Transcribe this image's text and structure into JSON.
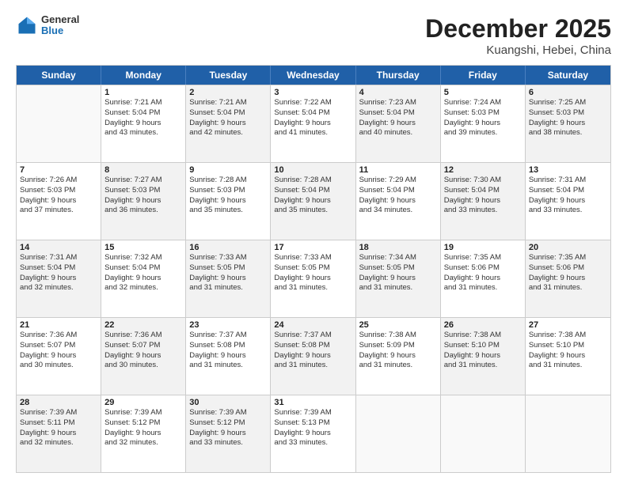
{
  "logo": {
    "general": "General",
    "blue": "Blue"
  },
  "header": {
    "title": "December 2025",
    "subtitle": "Kuangshi, Hebei, China"
  },
  "weekdays": [
    "Sunday",
    "Monday",
    "Tuesday",
    "Wednesday",
    "Thursday",
    "Friday",
    "Saturday"
  ],
  "weeks": [
    [
      {
        "day": "",
        "lines": [],
        "shade": false
      },
      {
        "day": "1",
        "lines": [
          "Sunrise: 7:21 AM",
          "Sunset: 5:04 PM",
          "Daylight: 9 hours",
          "and 43 minutes."
        ],
        "shade": false
      },
      {
        "day": "2",
        "lines": [
          "Sunrise: 7:21 AM",
          "Sunset: 5:04 PM",
          "Daylight: 9 hours",
          "and 42 minutes."
        ],
        "shade": true
      },
      {
        "day": "3",
        "lines": [
          "Sunrise: 7:22 AM",
          "Sunset: 5:04 PM",
          "Daylight: 9 hours",
          "and 41 minutes."
        ],
        "shade": false
      },
      {
        "day": "4",
        "lines": [
          "Sunrise: 7:23 AM",
          "Sunset: 5:04 PM",
          "Daylight: 9 hours",
          "and 40 minutes."
        ],
        "shade": true
      },
      {
        "day": "5",
        "lines": [
          "Sunrise: 7:24 AM",
          "Sunset: 5:03 PM",
          "Daylight: 9 hours",
          "and 39 minutes."
        ],
        "shade": false
      },
      {
        "day": "6",
        "lines": [
          "Sunrise: 7:25 AM",
          "Sunset: 5:03 PM",
          "Daylight: 9 hours",
          "and 38 minutes."
        ],
        "shade": true
      }
    ],
    [
      {
        "day": "7",
        "lines": [
          "Sunrise: 7:26 AM",
          "Sunset: 5:03 PM",
          "Daylight: 9 hours",
          "and 37 minutes."
        ],
        "shade": false
      },
      {
        "day": "8",
        "lines": [
          "Sunrise: 7:27 AM",
          "Sunset: 5:03 PM",
          "Daylight: 9 hours",
          "and 36 minutes."
        ],
        "shade": true
      },
      {
        "day": "9",
        "lines": [
          "Sunrise: 7:28 AM",
          "Sunset: 5:03 PM",
          "Daylight: 9 hours",
          "and 35 minutes."
        ],
        "shade": false
      },
      {
        "day": "10",
        "lines": [
          "Sunrise: 7:28 AM",
          "Sunset: 5:04 PM",
          "Daylight: 9 hours",
          "and 35 minutes."
        ],
        "shade": true
      },
      {
        "day": "11",
        "lines": [
          "Sunrise: 7:29 AM",
          "Sunset: 5:04 PM",
          "Daylight: 9 hours",
          "and 34 minutes."
        ],
        "shade": false
      },
      {
        "day": "12",
        "lines": [
          "Sunrise: 7:30 AM",
          "Sunset: 5:04 PM",
          "Daylight: 9 hours",
          "and 33 minutes."
        ],
        "shade": true
      },
      {
        "day": "13",
        "lines": [
          "Sunrise: 7:31 AM",
          "Sunset: 5:04 PM",
          "Daylight: 9 hours",
          "and 33 minutes."
        ],
        "shade": false
      }
    ],
    [
      {
        "day": "14",
        "lines": [
          "Sunrise: 7:31 AM",
          "Sunset: 5:04 PM",
          "Daylight: 9 hours",
          "and 32 minutes."
        ],
        "shade": true
      },
      {
        "day": "15",
        "lines": [
          "Sunrise: 7:32 AM",
          "Sunset: 5:04 PM",
          "Daylight: 9 hours",
          "and 32 minutes."
        ],
        "shade": false
      },
      {
        "day": "16",
        "lines": [
          "Sunrise: 7:33 AM",
          "Sunset: 5:05 PM",
          "Daylight: 9 hours",
          "and 31 minutes."
        ],
        "shade": true
      },
      {
        "day": "17",
        "lines": [
          "Sunrise: 7:33 AM",
          "Sunset: 5:05 PM",
          "Daylight: 9 hours",
          "and 31 minutes."
        ],
        "shade": false
      },
      {
        "day": "18",
        "lines": [
          "Sunrise: 7:34 AM",
          "Sunset: 5:05 PM",
          "Daylight: 9 hours",
          "and 31 minutes."
        ],
        "shade": true
      },
      {
        "day": "19",
        "lines": [
          "Sunrise: 7:35 AM",
          "Sunset: 5:06 PM",
          "Daylight: 9 hours",
          "and 31 minutes."
        ],
        "shade": false
      },
      {
        "day": "20",
        "lines": [
          "Sunrise: 7:35 AM",
          "Sunset: 5:06 PM",
          "Daylight: 9 hours",
          "and 31 minutes."
        ],
        "shade": true
      }
    ],
    [
      {
        "day": "21",
        "lines": [
          "Sunrise: 7:36 AM",
          "Sunset: 5:07 PM",
          "Daylight: 9 hours",
          "and 30 minutes."
        ],
        "shade": false
      },
      {
        "day": "22",
        "lines": [
          "Sunrise: 7:36 AM",
          "Sunset: 5:07 PM",
          "Daylight: 9 hours",
          "and 30 minutes."
        ],
        "shade": true
      },
      {
        "day": "23",
        "lines": [
          "Sunrise: 7:37 AM",
          "Sunset: 5:08 PM",
          "Daylight: 9 hours",
          "and 31 minutes."
        ],
        "shade": false
      },
      {
        "day": "24",
        "lines": [
          "Sunrise: 7:37 AM",
          "Sunset: 5:08 PM",
          "Daylight: 9 hours",
          "and 31 minutes."
        ],
        "shade": true
      },
      {
        "day": "25",
        "lines": [
          "Sunrise: 7:38 AM",
          "Sunset: 5:09 PM",
          "Daylight: 9 hours",
          "and 31 minutes."
        ],
        "shade": false
      },
      {
        "day": "26",
        "lines": [
          "Sunrise: 7:38 AM",
          "Sunset: 5:10 PM",
          "Daylight: 9 hours",
          "and 31 minutes."
        ],
        "shade": true
      },
      {
        "day": "27",
        "lines": [
          "Sunrise: 7:38 AM",
          "Sunset: 5:10 PM",
          "Daylight: 9 hours",
          "and 31 minutes."
        ],
        "shade": false
      }
    ],
    [
      {
        "day": "28",
        "lines": [
          "Sunrise: 7:39 AM",
          "Sunset: 5:11 PM",
          "Daylight: 9 hours",
          "and 32 minutes."
        ],
        "shade": true
      },
      {
        "day": "29",
        "lines": [
          "Sunrise: 7:39 AM",
          "Sunset: 5:12 PM",
          "Daylight: 9 hours",
          "and 32 minutes."
        ],
        "shade": false
      },
      {
        "day": "30",
        "lines": [
          "Sunrise: 7:39 AM",
          "Sunset: 5:12 PM",
          "Daylight: 9 hours",
          "and 33 minutes."
        ],
        "shade": true
      },
      {
        "day": "31",
        "lines": [
          "Sunrise: 7:39 AM",
          "Sunset: 5:13 PM",
          "Daylight: 9 hours",
          "and 33 minutes."
        ],
        "shade": false
      },
      {
        "day": "",
        "lines": [],
        "shade": false
      },
      {
        "day": "",
        "lines": [],
        "shade": false
      },
      {
        "day": "",
        "lines": [],
        "shade": false
      }
    ]
  ]
}
